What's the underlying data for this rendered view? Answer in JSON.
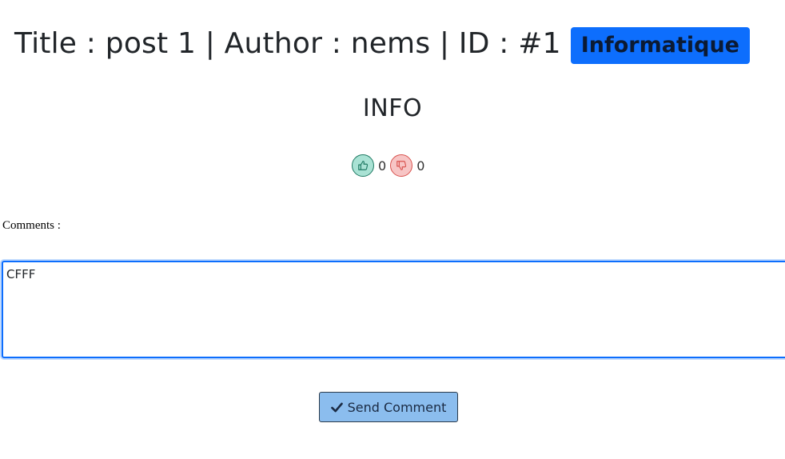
{
  "post": {
    "header_text": "Title : post 1 | Author : nems | ID : #1",
    "category": "Informatique",
    "content": "INFO"
  },
  "votes": {
    "likes": "0",
    "dislikes": "0",
    "like_icon": "thumbs-up-icon",
    "dislike_icon": "thumbs-down-icon"
  },
  "comments": {
    "label": "Comments :",
    "input_value": "CFFF",
    "send_label": "Send Comment",
    "send_icon": "check-icon"
  },
  "colors": {
    "accent": "#0d6efd",
    "send_button_bg": "#8bbdee",
    "like_bg": "#a9e2d4",
    "dislike_bg": "#f7c5c5"
  }
}
